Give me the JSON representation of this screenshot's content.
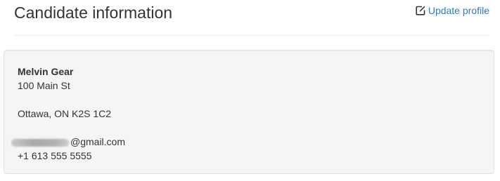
{
  "header": {
    "title": "Candidate information",
    "update_link": {
      "icon": "edit-icon",
      "label": "Update profile",
      "color": "#337ab7"
    }
  },
  "candidate": {
    "name": "Melvin Gear",
    "address_line1": "100 Main St",
    "city_line": "Ottawa, ON K2S 1C2",
    "email_domain": "@gmail.com",
    "phone": "+1 613 555 5555"
  },
  "colors": {
    "card_background": "#f5f5f5",
    "text": "#333333",
    "link": "#337ab7"
  }
}
